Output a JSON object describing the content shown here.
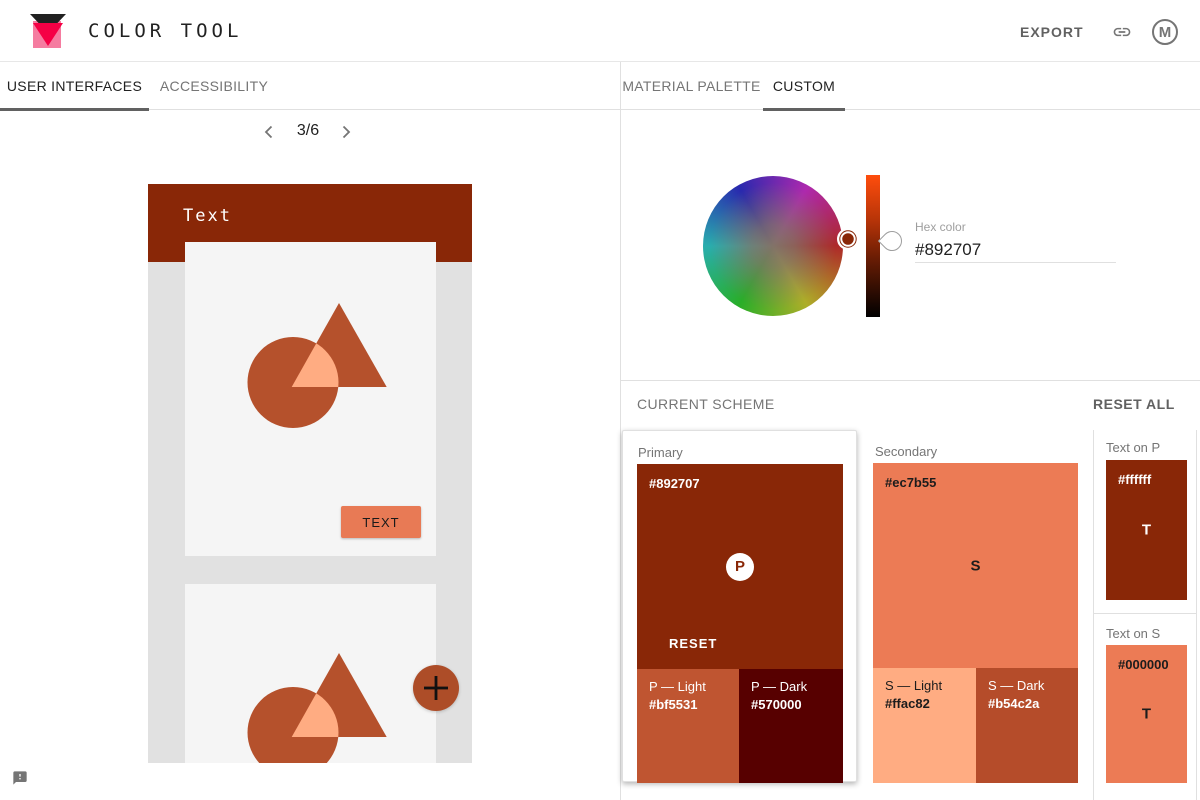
{
  "header": {
    "title": "COLOR TOOL",
    "export_label": "EXPORT",
    "avatar_label": "M"
  },
  "left_panel": {
    "tabs": [
      {
        "label": "USER INTERFACES"
      },
      {
        "label": "ACCESSIBILITY"
      }
    ],
    "pagination": {
      "current": "3/6"
    },
    "preview": {
      "appbar_title": "Text",
      "button_label": "TEXT"
    }
  },
  "right_panel": {
    "tabs": [
      {
        "label": "MATERIAL PALETTE"
      },
      {
        "label": "CUSTOM"
      }
    ],
    "picker": {
      "hex_label": "Hex color",
      "hex_value": "#892707"
    },
    "scheme": {
      "title": "CURRENT SCHEME",
      "reset_all_label": "RESET ALL",
      "primary": {
        "label": "Primary",
        "hex": "#892707",
        "chip": "P",
        "reset_label": "RESET",
        "light": {
          "label": "P — Light",
          "hex": "#bf5531"
        },
        "dark": {
          "label": "P — Dark",
          "hex": "#570000"
        }
      },
      "secondary": {
        "label": "Secondary",
        "hex": "#ec7b55",
        "chip": "S",
        "light": {
          "label": "S — Light",
          "hex": "#ffac82"
        },
        "dark": {
          "label": "S — Dark",
          "hex": "#b54c2a"
        }
      },
      "text_on_p": {
        "label": "Text on P",
        "hex": "#ffffff",
        "chip": "T"
      },
      "text_on_s": {
        "label": "Text on S",
        "hex": "#000000",
        "chip": "T"
      }
    }
  },
  "colors": {
    "primary": "#892707",
    "primary_light": "#bf5531",
    "primary_dark": "#570000",
    "secondary": "#ec7b55",
    "secondary_light": "#ffac82",
    "secondary_dark": "#b54c2a",
    "text_on_primary": "#ffffff",
    "text_on_secondary": "#000000",
    "artwork_shape": "#b5512c",
    "artwork_overlap": "#ffac82",
    "preview_button": "#e87a55",
    "fab": "#ad4d28",
    "logo_pink": "#f57ca0",
    "logo_red": "#f50045",
    "logo_black": "#212121",
    "icon_gray": "#757575"
  },
  "icons": {
    "link": "link-icon",
    "avatar": "material-logo-icon",
    "prev": "chevron-left-icon",
    "next": "chevron-right-icon",
    "feedback": "feedback-icon",
    "fab_plus": "plus-icon",
    "wheel_pin": "color-pin-icon",
    "slider_handle": "slider-handle-icon"
  }
}
